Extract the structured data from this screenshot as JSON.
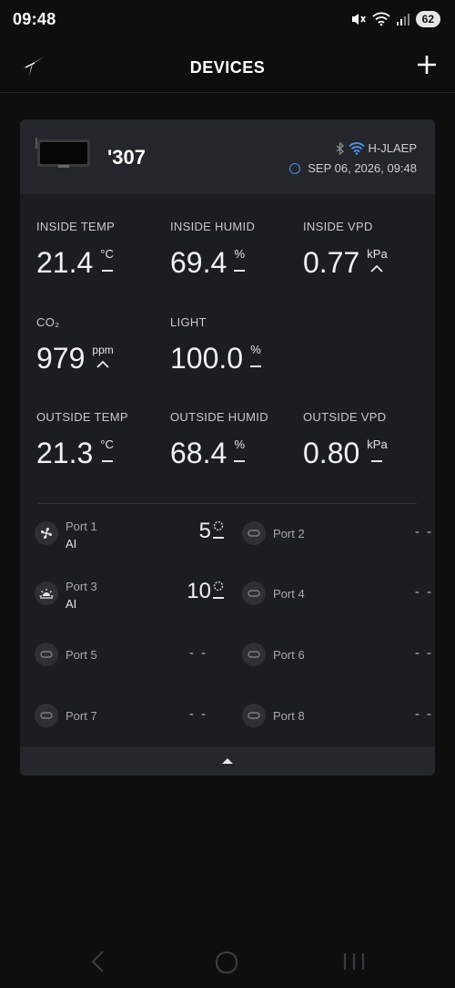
{
  "status": {
    "time": "09:48",
    "battery": "62"
  },
  "header": {
    "title": "DEVICES"
  },
  "device": {
    "name": "'307",
    "network": "H-JLAEP",
    "datetime": "SEP 06, 2026, 09:48"
  },
  "metrics": {
    "inside_temp": {
      "label": "INSIDE TEMP",
      "value": "21.4",
      "unit": "°C"
    },
    "inside_humid": {
      "label": "INSIDE HUMID",
      "value": "69.4",
      "unit": "%"
    },
    "inside_vpd": {
      "label": "INSIDE VPD",
      "value": "0.77",
      "unit": "kPa"
    },
    "co2": {
      "label": "CO₂",
      "value": "979",
      "unit": "ppm"
    },
    "light": {
      "label": "LIGHT",
      "value": "100.0",
      "unit": "%"
    },
    "outside_temp": {
      "label": "OUTSIDE TEMP",
      "value": "21.3",
      "unit": "°C"
    },
    "outside_humid": {
      "label": "OUTSIDE HUMID",
      "value": "68.4",
      "unit": "%"
    },
    "outside_vpd": {
      "label": "OUTSIDE VPD",
      "value": "0.80",
      "unit": "kPa"
    }
  },
  "ports": [
    {
      "name": "Port 1",
      "mode": "AI",
      "value": "5",
      "icon": "fan-icon"
    },
    {
      "name": "Port 2",
      "value": "- -",
      "icon": "plug-icon"
    },
    {
      "name": "Port 3",
      "mode": "AI",
      "value": "10",
      "icon": "sun-icon"
    },
    {
      "name": "Port 4",
      "value": "- -",
      "icon": "plug-icon"
    },
    {
      "name": "Port 5",
      "value": "- -",
      "icon": "plug-icon"
    },
    {
      "name": "Port 6",
      "value": "- -",
      "icon": "plug-icon"
    },
    {
      "name": "Port 7",
      "value": "- -",
      "icon": "plug-icon"
    },
    {
      "name": "Port 8",
      "value": "- -",
      "icon": "plug-icon"
    }
  ],
  "colors": {
    "accent": "#4a90e2",
    "background": "#0e0e0f",
    "card": "#1c1d20"
  }
}
